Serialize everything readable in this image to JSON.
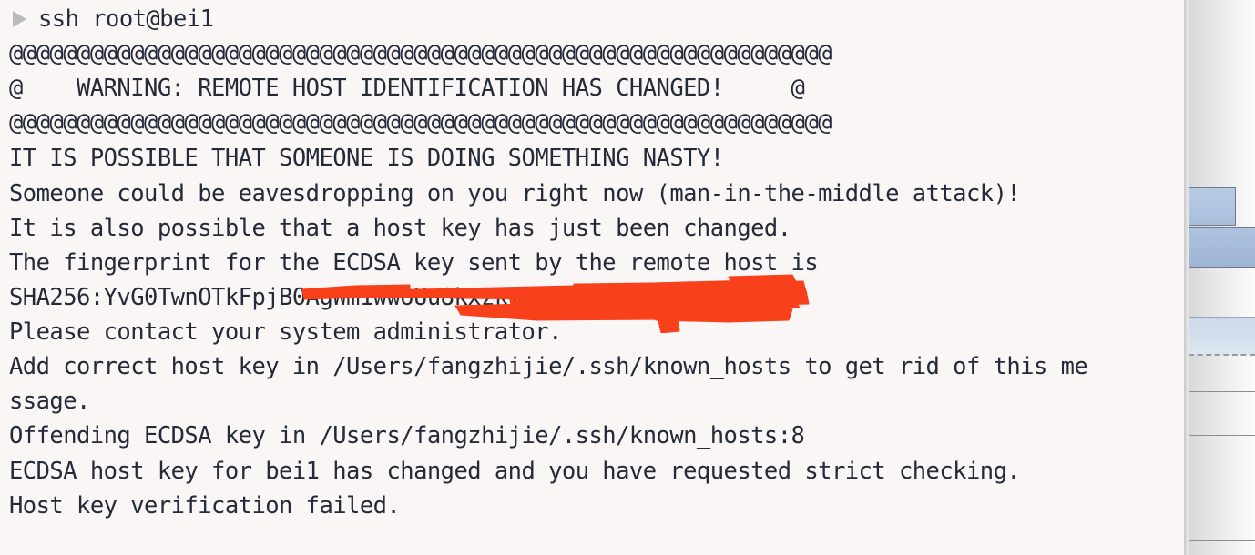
{
  "window": {
    "type": "terminal",
    "background_color": "#faf6f6",
    "text_color": "#242a38"
  },
  "terminal": {
    "prompt": {
      "glyph_name": "play-triangle-prompt",
      "glyph": "▶",
      "color": "#b9b9b9"
    },
    "command": "ssh root@bei1",
    "lines": [
      "@@@@@@@@@@@@@@@@@@@@@@@@@@@@@@@@@@@@@@@@@@@@@@@@@@@@@@@@@@@@@",
      "@    WARNING: REMOTE HOST IDENTIFICATION HAS CHANGED!     @",
      "@@@@@@@@@@@@@@@@@@@@@@@@@@@@@@@@@@@@@@@@@@@@@@@@@@@@@@@@@@@@@",
      "IT IS POSSIBLE THAT SOMEONE IS DOING SOMETHING NASTY!",
      "Someone could be eavesdropping on you right now (man-in-the-middle attack)!",
      "It is also possible that a host key has just been changed.",
      "The fingerprint for the ECDSA key sent by the remote host is",
      "SHA256:YvG0TwnOTkFpjB0AgWm1wwoUu8kxzkw…",
      "Please contact your system administrator.",
      "Add correct host key in /Users/fangzhijie/.ssh/known_hosts to get rid of this me",
      "ssage.",
      "Offending ECDSA key in /Users/fangzhijie/.ssh/known_hosts:8",
      "ECDSA host key for bei1 has changed and you have requested strict checking.",
      "Host key verification failed."
    ]
  },
  "annotation": {
    "name": "redaction-scribble",
    "color": "#f8401a",
    "target": "ssh-fingerprint-line",
    "description": "hand-drawn red strike-through covering the remainder of the SHA256 fingerprint"
  },
  "right_panel": {
    "name": "background-window-edge",
    "selection_color": "#a8bfdc",
    "surface_color": "#e6e6e6",
    "border_color": "#6f7b8c"
  }
}
